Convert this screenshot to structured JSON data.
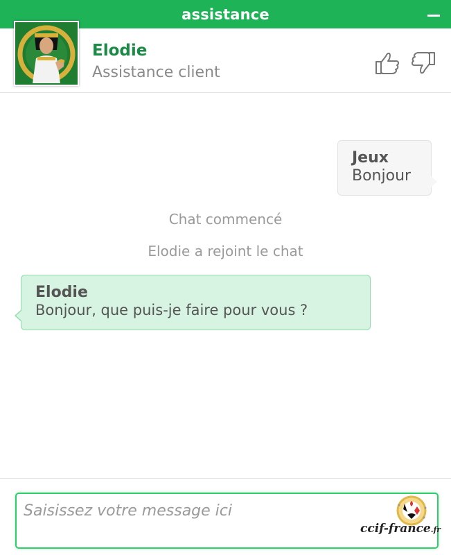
{
  "window": {
    "title": "assistance",
    "accent_color": "#1fb358"
  },
  "agent": {
    "name": "Elodie",
    "role": "Assistance client",
    "name_color": "#1a8a45"
  },
  "header_actions": {
    "thumbs_up_icon": "thumbs-up-icon",
    "thumbs_down_icon": "thumbs-down-icon"
  },
  "messages": [
    {
      "sender": "Jeux",
      "text": "Bonjour",
      "side": "user"
    },
    {
      "system": "Chat commencé"
    },
    {
      "system": "Elodie a rejoint le chat"
    },
    {
      "sender": "Elodie",
      "text": "Bonjour, que puis-je faire pour vous ?",
      "side": "agent"
    }
  ],
  "composer": {
    "placeholder": "Saisissez votre message ici",
    "value": ""
  },
  "watermark": {
    "text": "ccif-france",
    "suffix": ".fr"
  }
}
